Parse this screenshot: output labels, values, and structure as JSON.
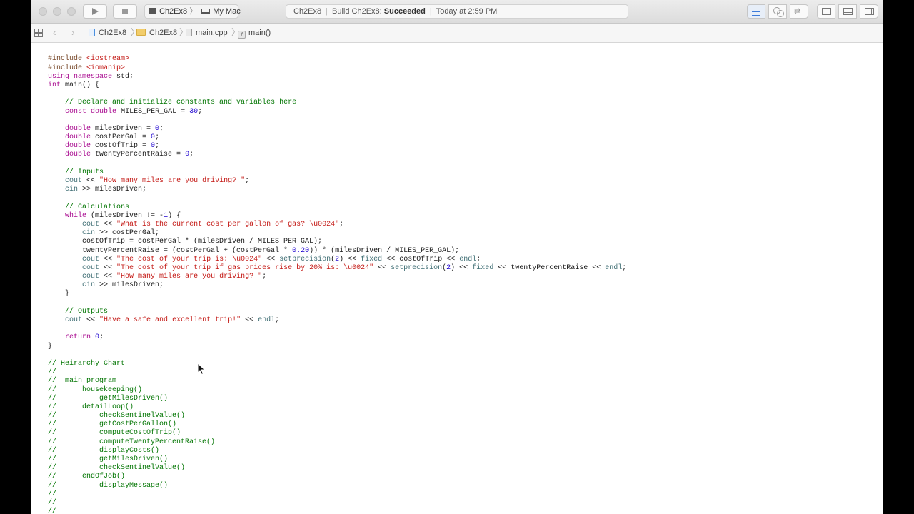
{
  "toolbar": {
    "scheme_target": "Ch2Ex8",
    "scheme_device": "My Mac",
    "activity_project": "Ch2Ex8",
    "activity_build_prefix": "Build Ch2Ex8:",
    "activity_build_status": "Succeeded",
    "activity_time": "Today at 2:59 PM"
  },
  "jumpbar": {
    "crumbs": [
      "Ch2Ex8",
      "Ch2Ex8",
      "main.cpp",
      "main()"
    ]
  },
  "code_lines": [
    [
      [
        "com",
        "//"
      ]
    ],
    [],
    [
      [
        "pp",
        "#include "
      ],
      [
        "str",
        "<iostream>"
      ]
    ],
    [
      [
        "pp",
        "#include "
      ],
      [
        "str",
        "<iomanip>"
      ]
    ],
    [
      [
        "kw",
        "using"
      ],
      [
        "t",
        " "
      ],
      [
        "kw",
        "namespace"
      ],
      [
        "t",
        " std;"
      ]
    ],
    [
      [
        "kw",
        "int"
      ],
      [
        "t",
        " main() {"
      ]
    ],
    [],
    [
      [
        "t",
        "    "
      ],
      [
        "com",
        "// Declare and initialize constants and variables here"
      ]
    ],
    [
      [
        "t",
        "    "
      ],
      [
        "kw",
        "const"
      ],
      [
        "t",
        " "
      ],
      [
        "kw",
        "double"
      ],
      [
        "t",
        " MILES_PER_GAL = "
      ],
      [
        "num",
        "30"
      ],
      [
        "t",
        ";"
      ]
    ],
    [],
    [
      [
        "t",
        "    "
      ],
      [
        "kw",
        "double"
      ],
      [
        "t",
        " milesDriven = "
      ],
      [
        "num",
        "0"
      ],
      [
        "t",
        ";"
      ]
    ],
    [
      [
        "t",
        "    "
      ],
      [
        "kw",
        "double"
      ],
      [
        "t",
        " costPerGal = "
      ],
      [
        "num",
        "0"
      ],
      [
        "t",
        ";"
      ]
    ],
    [
      [
        "t",
        "    "
      ],
      [
        "kw",
        "double"
      ],
      [
        "t",
        " costOfTrip = "
      ],
      [
        "num",
        "0"
      ],
      [
        "t",
        ";"
      ]
    ],
    [
      [
        "t",
        "    "
      ],
      [
        "kw",
        "double"
      ],
      [
        "t",
        " twentyPercentRaise = "
      ],
      [
        "num",
        "0"
      ],
      [
        "t",
        ";"
      ]
    ],
    [],
    [
      [
        "t",
        "    "
      ],
      [
        "com",
        "// Inputs"
      ]
    ],
    [
      [
        "t",
        "    "
      ],
      [
        "fn",
        "cout"
      ],
      [
        "t",
        " << "
      ],
      [
        "str",
        "\"How many miles are you driving? \""
      ],
      [
        "t",
        ";"
      ]
    ],
    [
      [
        "t",
        "    "
      ],
      [
        "fn",
        "cin"
      ],
      [
        "t",
        " >> milesDriven;"
      ]
    ],
    [],
    [
      [
        "t",
        "    "
      ],
      [
        "com",
        "// Calculations"
      ]
    ],
    [
      [
        "t",
        "    "
      ],
      [
        "kw",
        "while"
      ],
      [
        "t",
        " (milesDriven != -"
      ],
      [
        "num",
        "1"
      ],
      [
        "t",
        ") {"
      ]
    ],
    [
      [
        "t",
        "        "
      ],
      [
        "fn",
        "cout"
      ],
      [
        "t",
        " << "
      ],
      [
        "str",
        "\"What is the current cost per gallon of gas? \\u0024\""
      ],
      [
        "t",
        ";"
      ]
    ],
    [
      [
        "t",
        "        "
      ],
      [
        "fn",
        "cin"
      ],
      [
        "t",
        " >> costPerGal;"
      ]
    ],
    [
      [
        "t",
        "        costOfTrip = costPerGal * (milesDriven / MILES_PER_GAL);"
      ]
    ],
    [
      [
        "t",
        "        twentyPercentRaise = (costPerGal + (costPerGal * "
      ],
      [
        "num",
        "0.20"
      ],
      [
        "t",
        ")) * (milesDriven / MILES_PER_GAL);"
      ]
    ],
    [
      [
        "t",
        "        "
      ],
      [
        "fn",
        "cout"
      ],
      [
        "t",
        " << "
      ],
      [
        "str",
        "\"The cost of your trip is: \\u0024\""
      ],
      [
        "t",
        " << "
      ],
      [
        "fn",
        "setprecision"
      ],
      [
        "t",
        "("
      ],
      [
        "num",
        "2"
      ],
      [
        "t",
        ") << "
      ],
      [
        "fn",
        "fixed"
      ],
      [
        "t",
        " << costOfTrip << "
      ],
      [
        "fn",
        "endl"
      ],
      [
        "t",
        ";"
      ]
    ],
    [
      [
        "t",
        "        "
      ],
      [
        "fn",
        "cout"
      ],
      [
        "t",
        " << "
      ],
      [
        "str",
        "\"The cost of your trip if gas prices rise by 20% is: \\u0024\""
      ],
      [
        "t",
        " << "
      ],
      [
        "fn",
        "setprecision"
      ],
      [
        "t",
        "("
      ],
      [
        "num",
        "2"
      ],
      [
        "t",
        ") << "
      ],
      [
        "fn",
        "fixed"
      ],
      [
        "t",
        " << twentyPercentRaise << "
      ],
      [
        "fn",
        "endl"
      ],
      [
        "t",
        ";"
      ]
    ],
    [
      [
        "t",
        "        "
      ],
      [
        "fn",
        "cout"
      ],
      [
        "t",
        " << "
      ],
      [
        "str",
        "\"How many miles are you driving? \""
      ],
      [
        "t",
        ";"
      ]
    ],
    [
      [
        "t",
        "        "
      ],
      [
        "fn",
        "cin"
      ],
      [
        "t",
        " >> milesDriven;"
      ]
    ],
    [
      [
        "t",
        "    }"
      ]
    ],
    [],
    [
      [
        "t",
        "    "
      ],
      [
        "com",
        "// Outputs"
      ]
    ],
    [
      [
        "t",
        "    "
      ],
      [
        "fn",
        "cout"
      ],
      [
        "t",
        " << "
      ],
      [
        "str",
        "\"Have a safe and excellent trip!\""
      ],
      [
        "t",
        " << "
      ],
      [
        "fn",
        "endl"
      ],
      [
        "t",
        ";"
      ]
    ],
    [],
    [
      [
        "t",
        "    "
      ],
      [
        "kw",
        "return"
      ],
      [
        "t",
        " "
      ],
      [
        "num",
        "0"
      ],
      [
        "t",
        ";"
      ]
    ],
    [
      [
        "t",
        "}"
      ]
    ],
    [],
    [
      [
        "com",
        "// Heirarchy Chart"
      ]
    ],
    [
      [
        "com",
        "//"
      ]
    ],
    [
      [
        "com",
        "//  main program"
      ]
    ],
    [
      [
        "com",
        "//      housekeeping()"
      ]
    ],
    [
      [
        "com",
        "//          getMilesDriven()"
      ]
    ],
    [
      [
        "com",
        "//      detailLoop()"
      ]
    ],
    [
      [
        "com",
        "//          checkSentinelValue()"
      ]
    ],
    [
      [
        "com",
        "//          getCostPerGallon()"
      ]
    ],
    [
      [
        "com",
        "//          computeCostOfTrip()"
      ]
    ],
    [
      [
        "com",
        "//          computeTwentyPercentRaise()"
      ]
    ],
    [
      [
        "com",
        "//          displayCosts()"
      ]
    ],
    [
      [
        "com",
        "//          getMilesDriven()"
      ]
    ],
    [
      [
        "com",
        "//          checkSentinelValue()"
      ]
    ],
    [
      [
        "com",
        "//      endOfJob()"
      ]
    ],
    [
      [
        "com",
        "//          displayMessage()"
      ]
    ],
    [
      [
        "com",
        "//"
      ]
    ],
    [
      [
        "com",
        "//"
      ]
    ],
    [
      [
        "com",
        "//"
      ]
    ]
  ]
}
